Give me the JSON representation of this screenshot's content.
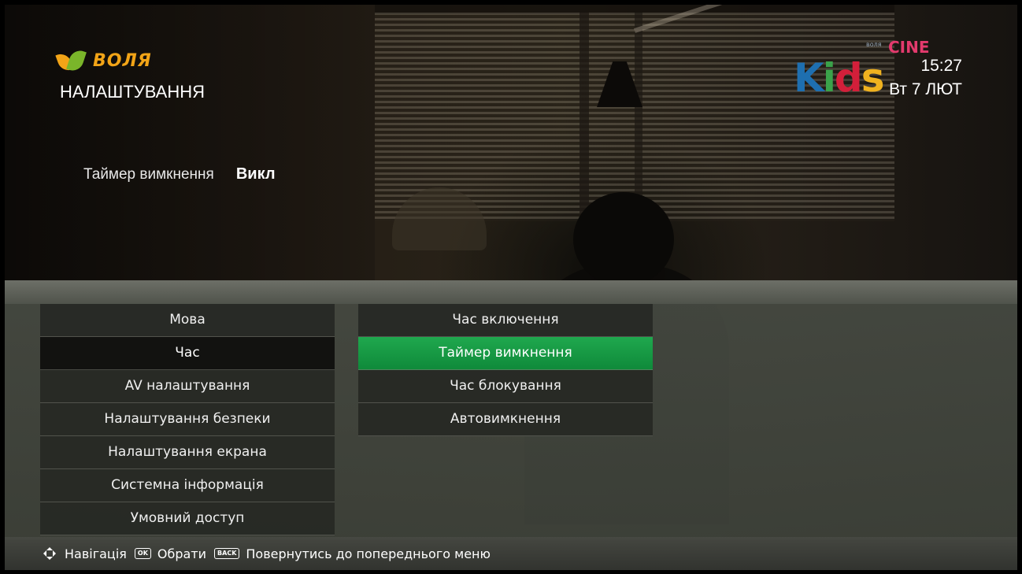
{
  "header": {
    "brand": "ВОЛЯ",
    "title": "НАЛАШТУВАННЯ"
  },
  "current_setting": {
    "label": "Таймер вимкнення",
    "value": "Викл"
  },
  "channel": {
    "logo_main": "Kids",
    "logo_sub": "CINE",
    "logo_small": "воля"
  },
  "clock": {
    "time": "15:27",
    "date": "Вт 7 ЛЮТ"
  },
  "menu": {
    "categories": [
      {
        "label": "Мова",
        "state": "normal"
      },
      {
        "label": "Час",
        "state": "selected"
      },
      {
        "label": "AV налаштування",
        "state": "normal"
      },
      {
        "label": "Налаштування безпеки",
        "state": "normal"
      },
      {
        "label": "Налаштування екрана",
        "state": "normal"
      },
      {
        "label": "Системна інформація",
        "state": "normal"
      },
      {
        "label": "Умовний доступ",
        "state": "normal"
      }
    ],
    "subitems": [
      {
        "label": "Час включення",
        "state": "normal"
      },
      {
        "label": "Таймер вимкнення",
        "state": "focused"
      },
      {
        "label": "Час блокування",
        "state": "normal"
      },
      {
        "label": "Автовимкнення",
        "state": "normal"
      }
    ]
  },
  "footer": {
    "nav_label": "Навігація",
    "ok_key": "OK",
    "ok_label": "Обрати",
    "back_key": "BACK",
    "back_label": "Повернутись до попереднього меню"
  },
  "colors": {
    "focus_green": "#1fa84e",
    "brand_orange": "#f2a417",
    "brand_green": "#7ab52a"
  }
}
